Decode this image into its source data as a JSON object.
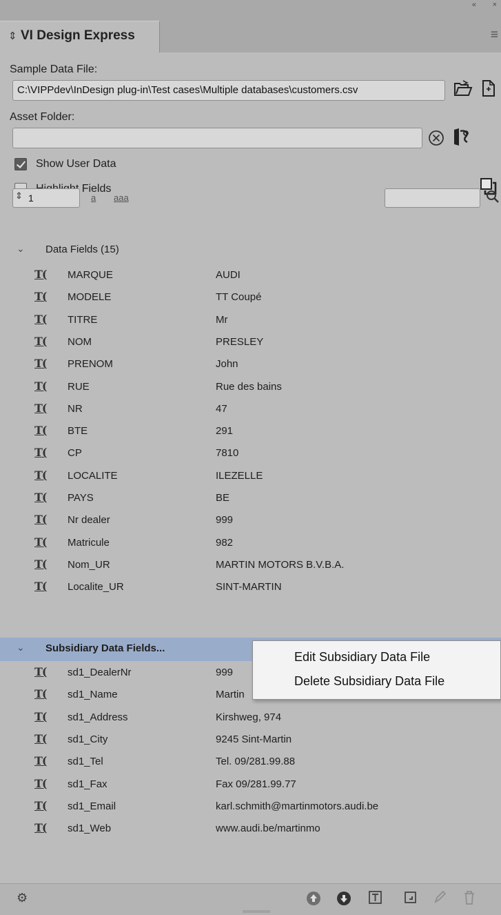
{
  "panel": {
    "title": "VI Design Express",
    "tab_arrows": "⇕",
    "menu_icon": "≡",
    "collapse_icon": "«",
    "close_icon": "×"
  },
  "sample_data": {
    "label": "Sample Data File:",
    "path": "C:\\VIPPdev\\InDesign plug-in\\Test cases\\Multiple databases\\customers.csv"
  },
  "asset_folder": {
    "label": "Asset Folder:",
    "value": ""
  },
  "options": {
    "show_user_data": "Show User Data",
    "show_user_data_checked": true,
    "highlight_fields": "Highlight Fields",
    "highlight_fields_checked": false
  },
  "record": {
    "value": "1",
    "case_lower": "a",
    "case_multi": "aaa",
    "search_value": ""
  },
  "data_fields": {
    "header": "Data Fields (15)",
    "rows": [
      {
        "name": "MARQUE",
        "value": "AUDI"
      },
      {
        "name": "MODELE",
        "value": "TT Coupé"
      },
      {
        "name": "TITRE",
        "value": "Mr"
      },
      {
        "name": "NOM",
        "value": "PRESLEY"
      },
      {
        "name": "PRENOM",
        "value": "John"
      },
      {
        "name": "RUE",
        "value": "Rue des bains"
      },
      {
        "name": "NR",
        "value": "47"
      },
      {
        "name": "BTE",
        "value": "291"
      },
      {
        "name": "CP",
        "value": "7810"
      },
      {
        "name": "LOCALITE",
        "value": "ILEZELLE"
      },
      {
        "name": "PAYS",
        "value": "BE"
      },
      {
        "name": "Nr dealer",
        "value": "999"
      },
      {
        "name": "Matricule",
        "value": "982"
      },
      {
        "name": "Nom_UR",
        "value": "MARTIN MOTORS B.V.B.A."
      },
      {
        "name": "Localite_UR",
        "value": "SINT-MARTIN"
      }
    ]
  },
  "subsidiary_fields": {
    "header": "Subsidiary Data Fields...",
    "rows": [
      {
        "name": "sd1_DealerNr",
        "value": "999"
      },
      {
        "name": "sd1_Name",
        "value": "Martin"
      },
      {
        "name": "sd1_Address",
        "value": "Kirshweg, 974"
      },
      {
        "name": "sd1_City",
        "value": "9245 Sint-Martin"
      },
      {
        "name": "sd1_Tel",
        "value": "Tel. 09/281.99.88"
      },
      {
        "name": "sd1_Fax",
        "value": "Fax 09/281.99.77"
      },
      {
        "name": "sd1_Email",
        "value": "karl.schmith@martinmotors.audi.be"
      },
      {
        "name": "sd1_Web",
        "value": "www.audi.be/martinmo"
      }
    ]
  },
  "context_menu": {
    "edit": "Edit Subsidiary Data File",
    "delete": "Delete Subsidiary Data File"
  },
  "field_icon_glyph": "T(",
  "colors": {
    "panel_bg": "#bcbcbc",
    "selected_row": "#99adcb",
    "menu_bg": "#f3f3f3"
  }
}
